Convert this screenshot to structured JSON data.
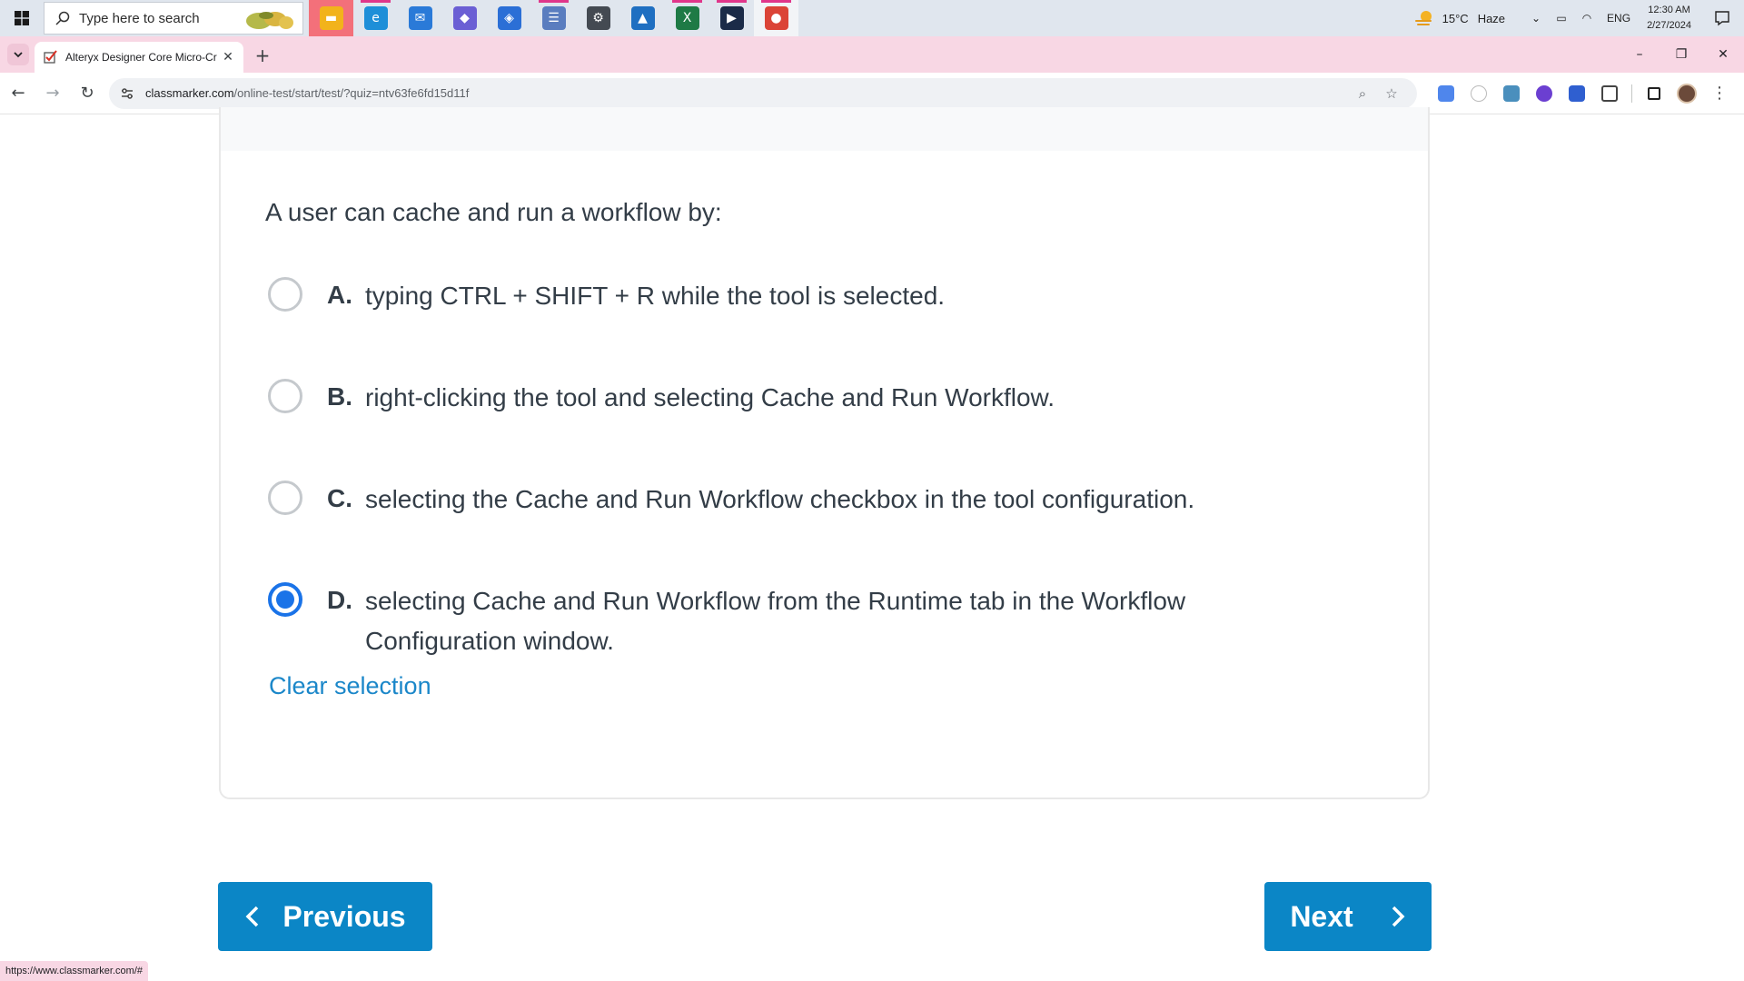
{
  "taskbar": {
    "search_placeholder": "Type here to search",
    "apps": [
      {
        "name": "file-explorer-icon",
        "color": "#f2b31b",
        "glyph": "▬",
        "highlight": true
      },
      {
        "name": "edge-icon",
        "color": "#1e8fd8",
        "glyph": "e",
        "running": true
      },
      {
        "name": "mail-icon",
        "color": "#2a7ad8",
        "glyph": "✉"
      },
      {
        "name": "copilot-icon",
        "color": "#6b5fd4",
        "glyph": "◆"
      },
      {
        "name": "teams-icon",
        "color": "#2b6fd6",
        "glyph": "◈"
      },
      {
        "name": "contacts-icon",
        "color": "#5a7dbf",
        "glyph": "☰",
        "running": true
      },
      {
        "name": "settings-icon",
        "color": "#444a52",
        "glyph": "⚙"
      },
      {
        "name": "photos-icon",
        "color": "#1f6fc1",
        "glyph": "▲"
      },
      {
        "name": "excel-icon",
        "color": "#1e7a45",
        "glyph": "X",
        "running": true
      },
      {
        "name": "terminal-icon",
        "color": "#1b2b48",
        "glyph": "▶",
        "running": true
      },
      {
        "name": "chrome-icon",
        "color": "#db4437",
        "glyph": "●",
        "running": true,
        "active": true
      }
    ],
    "weather_temp": "15°C",
    "weather_cond": "Haze",
    "language": "ENG",
    "time": "12:30 AM",
    "date": "2/27/2024"
  },
  "browser": {
    "tab_title": "Alteryx Designer Core Micro-Cr",
    "url_host": "classmarker.com",
    "url_path": "/online-test/start/test/?quiz=ntv63fe6fd15d11f",
    "status_url": "https://www.classmarker.com/#"
  },
  "quiz": {
    "question": "A user can cache and run a workflow by:",
    "options": [
      {
        "letter": "A.",
        "text": "typing CTRL + SHIFT + R while the tool is selected.",
        "selected": false
      },
      {
        "letter": "B.",
        "text": "right-clicking the tool and selecting Cache and Run Workflow.",
        "selected": false
      },
      {
        "letter": "C.",
        "text": "selecting the Cache and Run Workflow checkbox in the tool configuration.",
        "selected": false
      },
      {
        "letter": "D.",
        "text": "selecting Cache and Run Workflow from the Runtime tab in the Workflow Configuration window.",
        "selected": true
      }
    ],
    "clear_selection": "Clear selection",
    "prev_label": "Previous",
    "next_label": "Next"
  },
  "colors": {
    "accent": "#0b86c6",
    "radio_selected": "#1a73e8",
    "link": "#1b87c9",
    "tabstrip": "#f8d7e4"
  }
}
